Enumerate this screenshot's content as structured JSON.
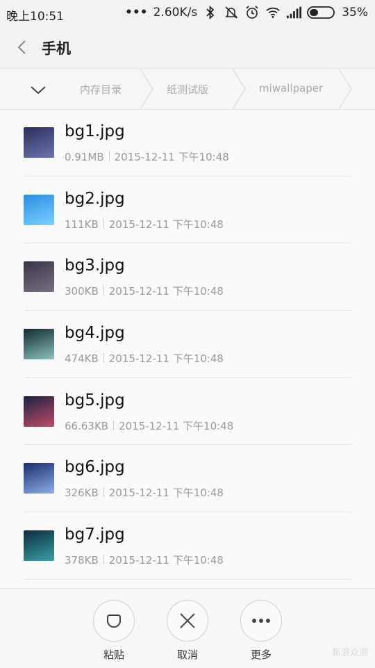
{
  "status": {
    "time": "晚上10:51",
    "speed": "2.60K/s",
    "battery": "35%"
  },
  "header": {
    "title": "手机"
  },
  "breadcrumb": {
    "items": [
      "内存目录",
      "纸测试版",
      "miwallpaper"
    ]
  },
  "files": [
    {
      "name": "bg1.jpg",
      "size": "0.91MB",
      "date": "2015-12-11 下午10:48",
      "colors": [
        "#2a2f5c",
        "#6e74b0"
      ]
    },
    {
      "name": "bg2.jpg",
      "size": "111KB",
      "date": "2015-12-11 下午10:48",
      "colors": [
        "#2a8de0",
        "#7bd1ff"
      ]
    },
    {
      "name": "bg3.jpg",
      "size": "300KB",
      "date": "2015-12-11 下午10:48",
      "colors": [
        "#3a3448",
        "#7a6f82"
      ]
    },
    {
      "name": "bg4.jpg",
      "size": "474KB",
      "date": "2015-12-11 下午10:48",
      "colors": [
        "#0e2a2e",
        "#8fc2c0"
      ]
    },
    {
      "name": "bg5.jpg",
      "size": "66.63KB",
      "date": "2015-12-11 下午10:48",
      "colors": [
        "#1e2340",
        "#c04a6a"
      ]
    },
    {
      "name": "bg6.jpg",
      "size": "326KB",
      "date": "2015-12-11 下午10:48",
      "colors": [
        "#1c2c6a",
        "#8ab0e8"
      ]
    },
    {
      "name": "bg7.jpg",
      "size": "378KB",
      "date": "2015-12-11 下午10:48",
      "colors": [
        "#0c2a3a",
        "#3aa0a8"
      ]
    }
  ],
  "actions": {
    "paste": "粘贴",
    "cancel": "取消",
    "more": "更多"
  },
  "watermark": "新浪众测"
}
